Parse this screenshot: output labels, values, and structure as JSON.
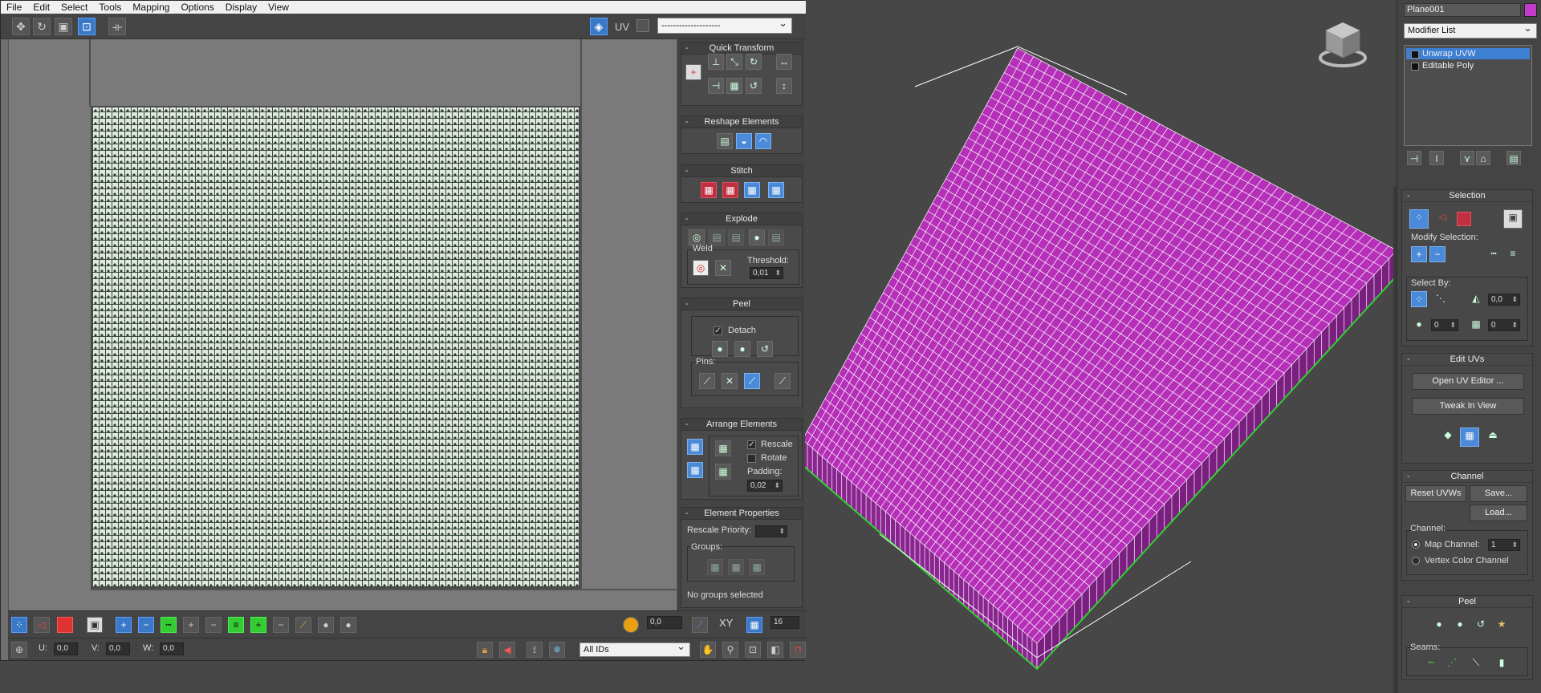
{
  "uv_editor": {
    "menu": [
      "File",
      "Edit",
      "Select",
      "Tools",
      "Mapping",
      "Options",
      "Display",
      "View"
    ],
    "toolbar": {
      "uv_label": "UV",
      "map_dropdown": "--------------------",
      "icons": [
        "move-icon",
        "rotate-icon",
        "scale-icon",
        "freeform-icon",
        "mirror-icon",
        "checker-icon",
        "channel-icon"
      ]
    },
    "quick_transform": {
      "title": "Quick Transform"
    },
    "reshape_elements": {
      "title": "Reshape Elements"
    },
    "stitch": {
      "title": "Stitch"
    },
    "explode": {
      "title": "Explode",
      "weld_label": "Weld",
      "threshold_label": "Threshold:",
      "threshold_value": "0,01"
    },
    "peel": {
      "title": "Peel",
      "detach_label": "Detach",
      "detach_checked": true,
      "pins_label": "Pins:"
    },
    "arrange_elements": {
      "title": "Arrange Elements",
      "rescale_label": "Rescale",
      "rescale_checked": true,
      "rotate_label": "Rotate",
      "rotate_checked": false,
      "padding_label": "Padding:",
      "padding_value": "0,02"
    },
    "element_properties": {
      "title": "Element Properties",
      "rescale_priority_label": "Rescale Priority:",
      "rescale_priority_value": "",
      "groups_label": "Groups:",
      "status": "No groups selected"
    },
    "bottom_bar": {
      "soft_value": "0,0",
      "xy_label": "XY",
      "grid_value": "16",
      "u_label": "U:",
      "u_value": "0,0",
      "v_label": "V:",
      "v_value": "0,0",
      "w_label": "W:",
      "w_value": "0,0",
      "id_filter": "All IDs"
    }
  },
  "viewport": {
    "mesh_color": "#b52fb8",
    "wire_color": "#ffffff",
    "edge_color": "#2fd12f"
  },
  "command_panel": {
    "object_name": "Plane001",
    "object_color": "#c23bc9",
    "modifier_list": "Modifier List",
    "stack": [
      {
        "label": "Unwrap UVW",
        "selected": true
      },
      {
        "label": "Editable Poly",
        "selected": false
      }
    ],
    "selection": {
      "title": "Selection",
      "modify_selection_label": "Modify Selection:",
      "select_by_label": "Select By:",
      "angle_value": "0,0",
      "spin1": "0",
      "spin2": "0"
    },
    "edit_uvs": {
      "title": "Edit UVs",
      "open_uv_editor": "Open UV Editor ...",
      "tweak_in_view": "Tweak In View"
    },
    "channel": {
      "title": "Channel",
      "reset_uvws": "Reset UVWs",
      "save": "Save...",
      "load": "Load...",
      "channel_label": "Channel:",
      "map_channel_label": "Map Channel:",
      "map_channel_value": "1",
      "vertex_color_label": "Vertex Color Channel"
    },
    "peel": {
      "title": "Peel",
      "seams_label": "Seams:"
    }
  }
}
